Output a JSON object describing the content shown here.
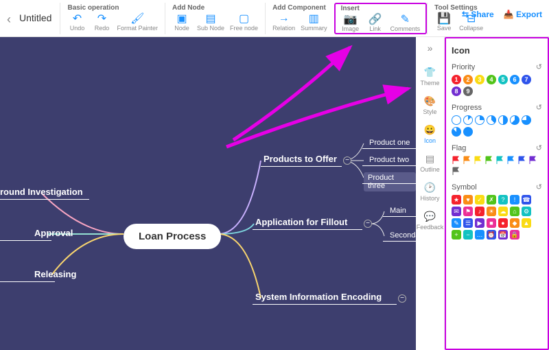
{
  "header": {
    "title": "Untitled"
  },
  "toolbar": {
    "groups": [
      {
        "label": "Basic operation",
        "items": [
          "Undo",
          "Redo",
          "Format Painter"
        ]
      },
      {
        "label": "Add Node",
        "items": [
          "Node",
          "Sub Node",
          "Free node"
        ]
      },
      {
        "label": "Add Component",
        "items": [
          "Relation",
          "Summary"
        ]
      },
      {
        "label": "Insert",
        "items": [
          "Image",
          "Link",
          "Comments"
        ],
        "highlight": true
      },
      {
        "label": "Tool Settings",
        "items": [
          "Save",
          "Collapse"
        ]
      }
    ],
    "share": "Share",
    "export": "Export"
  },
  "mindmap": {
    "center": "Loan Process",
    "left": [
      "round Investigation",
      "Approval",
      "Releasing"
    ],
    "right": [
      {
        "label": "Products to Offer",
        "children": [
          "Product one",
          "Product two",
          "Product three"
        ]
      },
      {
        "label": "Application for Fillout",
        "children": [
          "Main",
          "Secondary"
        ]
      },
      {
        "label": "System Information Encoding",
        "children": []
      }
    ]
  },
  "panel": {
    "title": "Icon",
    "tabs": [
      "Theme",
      "Style",
      "Icon",
      "Outline",
      "History",
      "Feedback"
    ],
    "sections": {
      "priority": {
        "label": "Priority",
        "colors": [
          "#f5222d",
          "#fa8c16",
          "#fadb14",
          "#52c41a",
          "#13c2c2",
          "#1890ff",
          "#2f54eb",
          "#722ed1",
          "#666"
        ]
      },
      "progress": {
        "label": "Progress"
      },
      "flag": {
        "label": "Flag",
        "colors": [
          "#f5222d",
          "#fa8c16",
          "#fadb14",
          "#52c41a",
          "#13c2c2",
          "#1890ff",
          "#2f54eb",
          "#722ed1",
          "#666"
        ]
      },
      "symbol": {
        "label": "Symbol"
      }
    }
  }
}
